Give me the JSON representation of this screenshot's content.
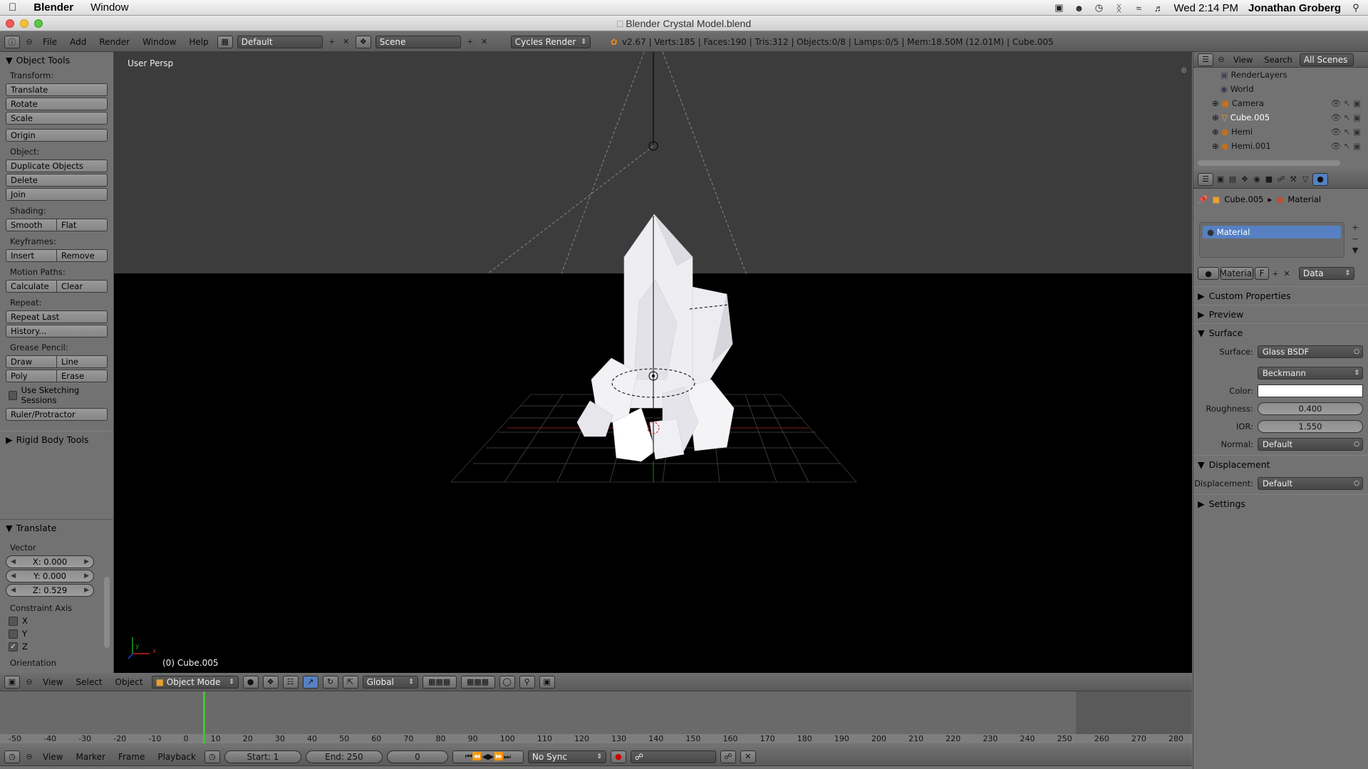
{
  "menubar": {
    "app": "Blender",
    "window": "Window",
    "clock": "Wed 2:14 PM",
    "user": "Jonathan Groberg"
  },
  "window": {
    "title": "Blender Crystal Model.blend"
  },
  "header": {
    "menus": [
      "File",
      "Add",
      "Render",
      "Window",
      "Help"
    ],
    "screen_layout": "Default",
    "scene": "Scene",
    "engine": "Cycles Render",
    "stats": "v2.67 | Verts:185 | Faces:190 | Tris:312 | Objects:0/8 | Lamps:0/5 | Mem:18.50M (12.01M) | Cube.005"
  },
  "tools": {
    "title": "Object Tools",
    "transform_label": "Transform:",
    "translate": "Translate",
    "rotate": "Rotate",
    "scale": "Scale",
    "origin": "Origin",
    "object_label": "Object:",
    "duplicate": "Duplicate Objects",
    "delete": "Delete",
    "join": "Join",
    "shading_label": "Shading:",
    "smooth": "Smooth",
    "flat": "Flat",
    "keyframes_label": "Keyframes:",
    "insert": "Insert",
    "remove": "Remove",
    "motion_label": "Motion Paths:",
    "calculate": "Calculate",
    "clear": "Clear",
    "repeat_label": "Repeat:",
    "repeat_last": "Repeat Last",
    "history": "History...",
    "grease_label": "Grease Pencil:",
    "draw": "Draw",
    "line": "Line",
    "poly": "Poly",
    "erase": "Erase",
    "sketching": "Use Sketching Sessions",
    "ruler": "Ruler/Protractor",
    "rigid_body": "Rigid Body Tools"
  },
  "operator": {
    "title": "Translate",
    "vector_label": "Vector",
    "x": "X: 0.000",
    "y": "Y: 0.000",
    "z": "Z: 0.529",
    "constraint_label": "Constraint Axis",
    "axis_x": "X",
    "axis_y": "Y",
    "axis_z": "Z",
    "orientation_label": "Orientation"
  },
  "viewport": {
    "view_name": "User Persp",
    "object_info": "(0) Cube.005",
    "axis_x": "x",
    "axis_y": "y"
  },
  "view3d_header": {
    "view": "View",
    "select": "Select",
    "object": "Object",
    "mode": "Object Mode",
    "orientation": "Global"
  },
  "timeline": {
    "ticks": [
      "-50",
      "-40",
      "-30",
      "-20",
      "-10",
      "0",
      "10",
      "20",
      "30",
      "40",
      "50",
      "60",
      "70",
      "80",
      "90",
      "100",
      "110",
      "120",
      "130",
      "140",
      "150",
      "160",
      "170",
      "180",
      "190",
      "200",
      "210",
      "220",
      "230",
      "240",
      "250",
      "260",
      "270",
      "280"
    ],
    "current_frame_marker": 0,
    "menus": [
      "View",
      "Marker",
      "Frame",
      "Playback"
    ],
    "start": "Start: 1",
    "end": "End: 250",
    "frame": "0",
    "sync": "No Sync"
  },
  "outliner": {
    "view": "View",
    "search": "Search",
    "scenes": "All Scenes",
    "items": [
      "RenderLayers",
      "World",
      "Camera",
      "Cube.005",
      "Hemi",
      "Hemi.001"
    ]
  },
  "properties": {
    "breadcrumb_object": "Cube.005",
    "breadcrumb_material": "Material",
    "slot": "Material",
    "datablock": "Material",
    "fake_user": "F",
    "link": "Data",
    "custom_properties": "Custom Properties",
    "preview": "Preview",
    "surface_panel": "Surface",
    "surface_label": "Surface:",
    "surface_value": "Glass BSDF",
    "distribution": "Beckmann",
    "color_label": "Color:",
    "color_value": "#ffffff",
    "roughness_label": "Roughness:",
    "roughness": "0.400",
    "ior_label": "IOR:",
    "ior": "1.550",
    "normal_label": "Normal:",
    "normal_value": "Default",
    "displacement_panel": "Displacement",
    "displacement_label": "Displacement:",
    "displacement_value": "Default",
    "settings": "Settings"
  }
}
